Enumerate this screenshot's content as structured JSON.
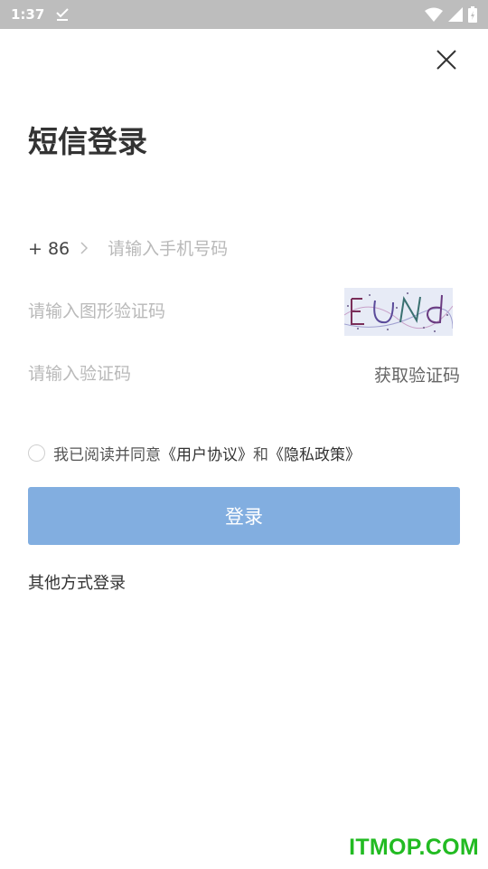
{
  "status_bar": {
    "time": "1:37",
    "icons": [
      "download-done-icon",
      "wifi-icon",
      "signal-icon",
      "battery-icon"
    ]
  },
  "header": {
    "close_icon": "close-icon",
    "title": "短信登录"
  },
  "form": {
    "country_code": "+ 86",
    "phone_placeholder": "请输入手机号码",
    "captcha_placeholder": "请输入图形验证码",
    "captcha_image_text": "EUNd",
    "sms_placeholder": "请输入验证码",
    "get_code_label": "获取验证码"
  },
  "agreement": {
    "prefix": "我已阅读并同意",
    "user_agreement": "《用户协议》",
    "connector": "和",
    "privacy_policy": "《隐私政策》"
  },
  "login_button": "登录",
  "other_login": "其他方式登录",
  "watermark": "ITMOP.COM",
  "colors": {
    "status_bar": "#bdbdbd",
    "primary_button": "#82aee0",
    "placeholder": "#b9b9b9",
    "watermark": "#22bb22"
  }
}
